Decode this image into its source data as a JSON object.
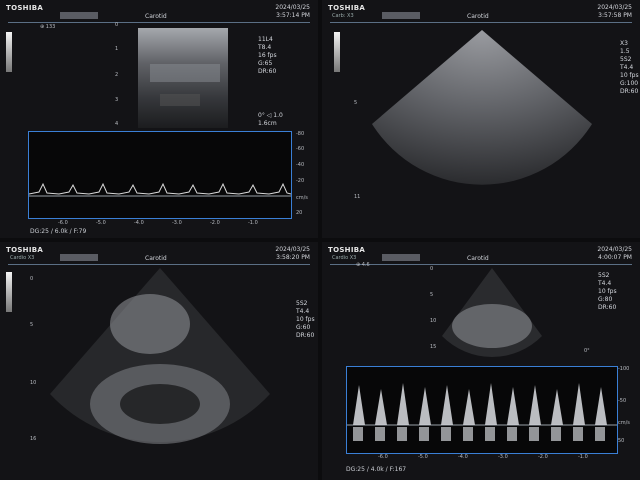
{
  "panels": [
    {
      "brand": "TOSHIBA",
      "sub": "",
      "marker": "⊕ 133",
      "title": "Carotid",
      "date": "2024/03/25",
      "time": "3:57:14 PM",
      "params": [
        "11L4",
        "T8.4",
        "16 fps",
        "",
        "G:65",
        "DR:60"
      ],
      "depth_ticks": [
        "0",
        "1",
        "2",
        "3",
        "4"
      ],
      "angle": "0°",
      "angle_val": "◁ 1.0",
      "gate": "1.6cm",
      "velocity_scale": [
        "-80",
        "-60",
        "-40",
        "-20",
        "cm/s",
        "20"
      ],
      "time_axis": [
        "-6.0",
        "-5.0",
        "-4.0",
        "-3.0",
        "-2.0",
        "-1.0"
      ],
      "footer": "DG:25 / 6.0k / F:79"
    },
    {
      "brand": "TOSHIBA",
      "sub": "Carb: X3",
      "title": "Carotid",
      "date": "2024/03/25",
      "time": "3:57:58 PM",
      "params": [
        "X3",
        "1.5",
        "5S2",
        "T4.4",
        "10 fps",
        "",
        "G:100",
        "DR:60"
      ],
      "depth_ticks": [
        "5",
        "11"
      ]
    },
    {
      "brand": "TOSHIBA",
      "sub": "Cardio X3",
      "title": "Carotid",
      "date": "2024/03/25",
      "time": "3:58:20 PM",
      "params": [
        "5S2",
        "T4.4",
        "10 fps",
        "",
        "G:60",
        "DR:60"
      ],
      "depth_ticks": [
        "0",
        "5",
        "10",
        "16"
      ]
    },
    {
      "brand": "TOSHIBA",
      "sub": "Cardio X3",
      "marker": "⊕ 4.6",
      "title": "Carotid",
      "date": "2024/03/25",
      "time": "4:00:07 PM",
      "params": [
        "5S2",
        "T4.4",
        "10 fps",
        "",
        "G:80",
        "DR:60"
      ],
      "depth_ticks": [
        "0",
        "5",
        "10",
        "15"
      ],
      "angle": "0°",
      "velocity_scale": [
        "-100",
        "-50",
        "cm/s",
        "50"
      ],
      "time_axis": [
        "-6.0",
        "-5.0",
        "-4.0",
        "-3.0",
        "-2.0",
        "-1.0"
      ],
      "footer": "DG:25 / 4.0k / F:167"
    }
  ],
  "colors": {
    "doppler_border": "#3a7fd6",
    "bg": "#131316",
    "text": "#d5d8de"
  }
}
